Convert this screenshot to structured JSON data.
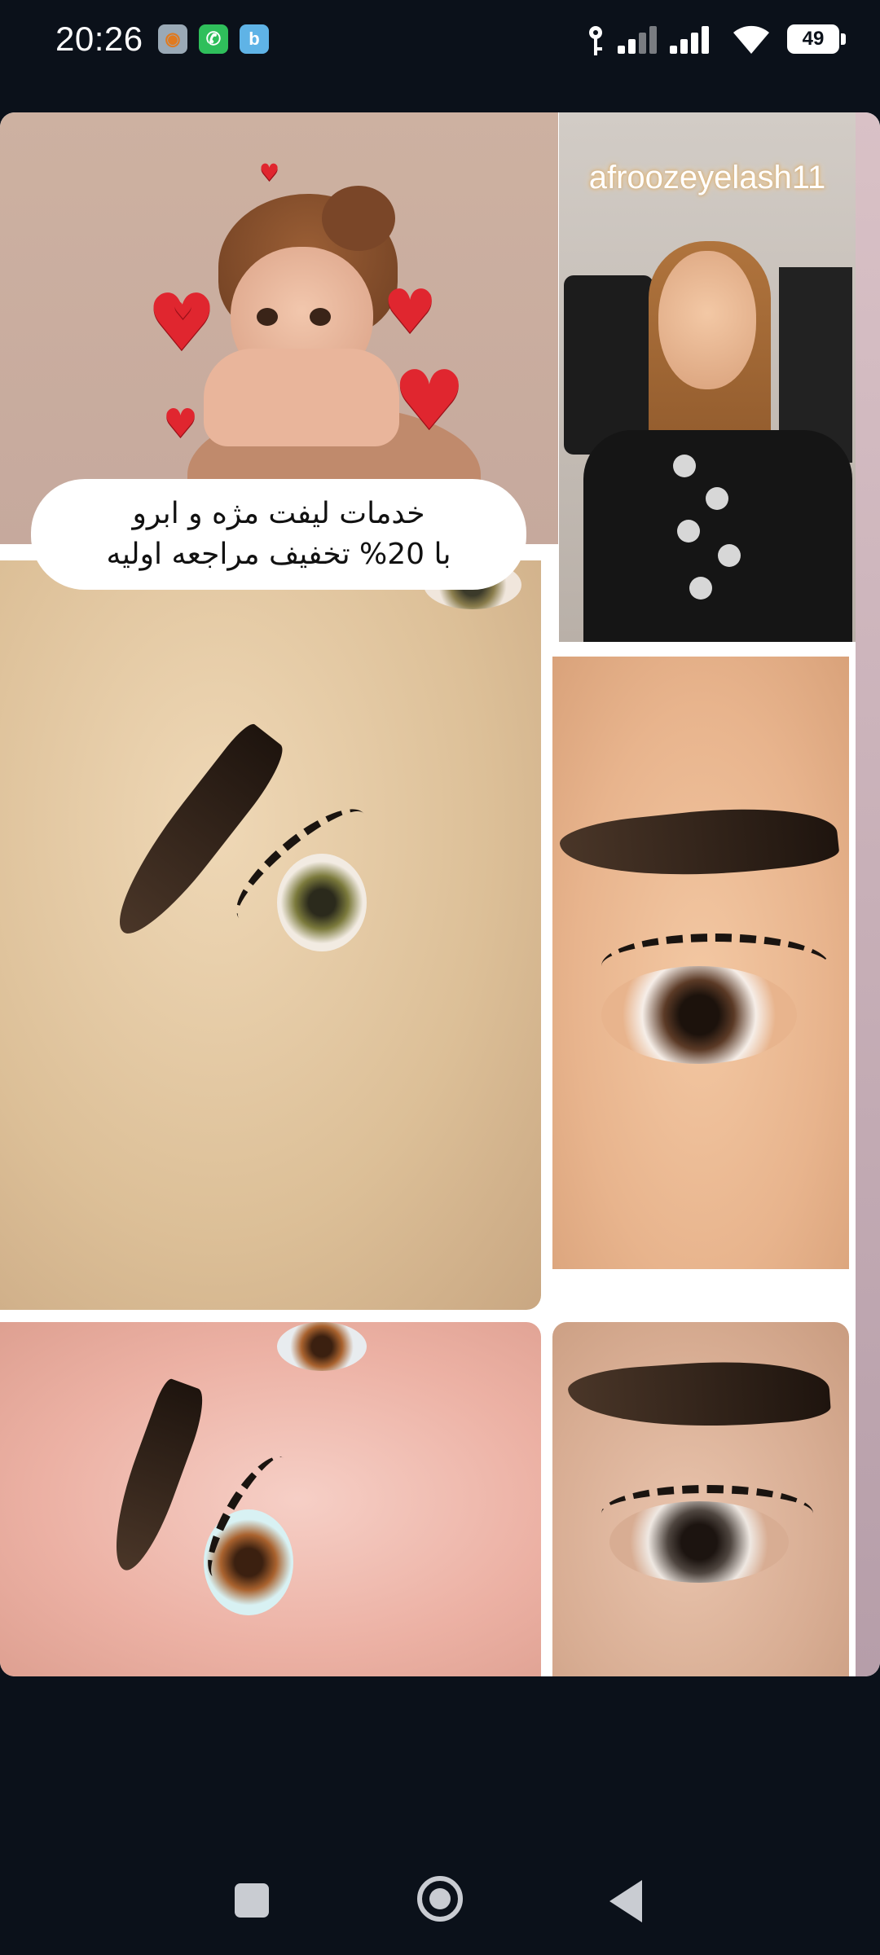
{
  "status_bar": {
    "time": "20:26",
    "notification_icons": [
      "vpn-app-icon",
      "phone-app-icon",
      "messenger-app-icon"
    ],
    "battery_level": "49",
    "system_icons": [
      "key-icon",
      "signal-icon",
      "signal-icon",
      "wifi-icon",
      "battery-icon"
    ]
  },
  "post": {
    "profile_handle": "afroozeyelash11",
    "promo_line1": "خدمات لیفت مژه و ابرو",
    "promo_line2": "با 20% تخفیف مراجعه اولیه",
    "images": [
      "cartoon-girl-with-hearts",
      "profile-photo",
      "eyebrow-and-lash-lift-1",
      "eyebrow-and-lash-lift-2",
      "eyebrow-and-lash-lift-3",
      "eyebrow-and-lash-lift-4"
    ]
  },
  "colors": {
    "background": "#0b111a",
    "heart": "#e0262f",
    "bubble": "#ffffff"
  },
  "nav_bar": {
    "buttons": [
      "recent-apps-button",
      "home-button",
      "back-button"
    ]
  }
}
